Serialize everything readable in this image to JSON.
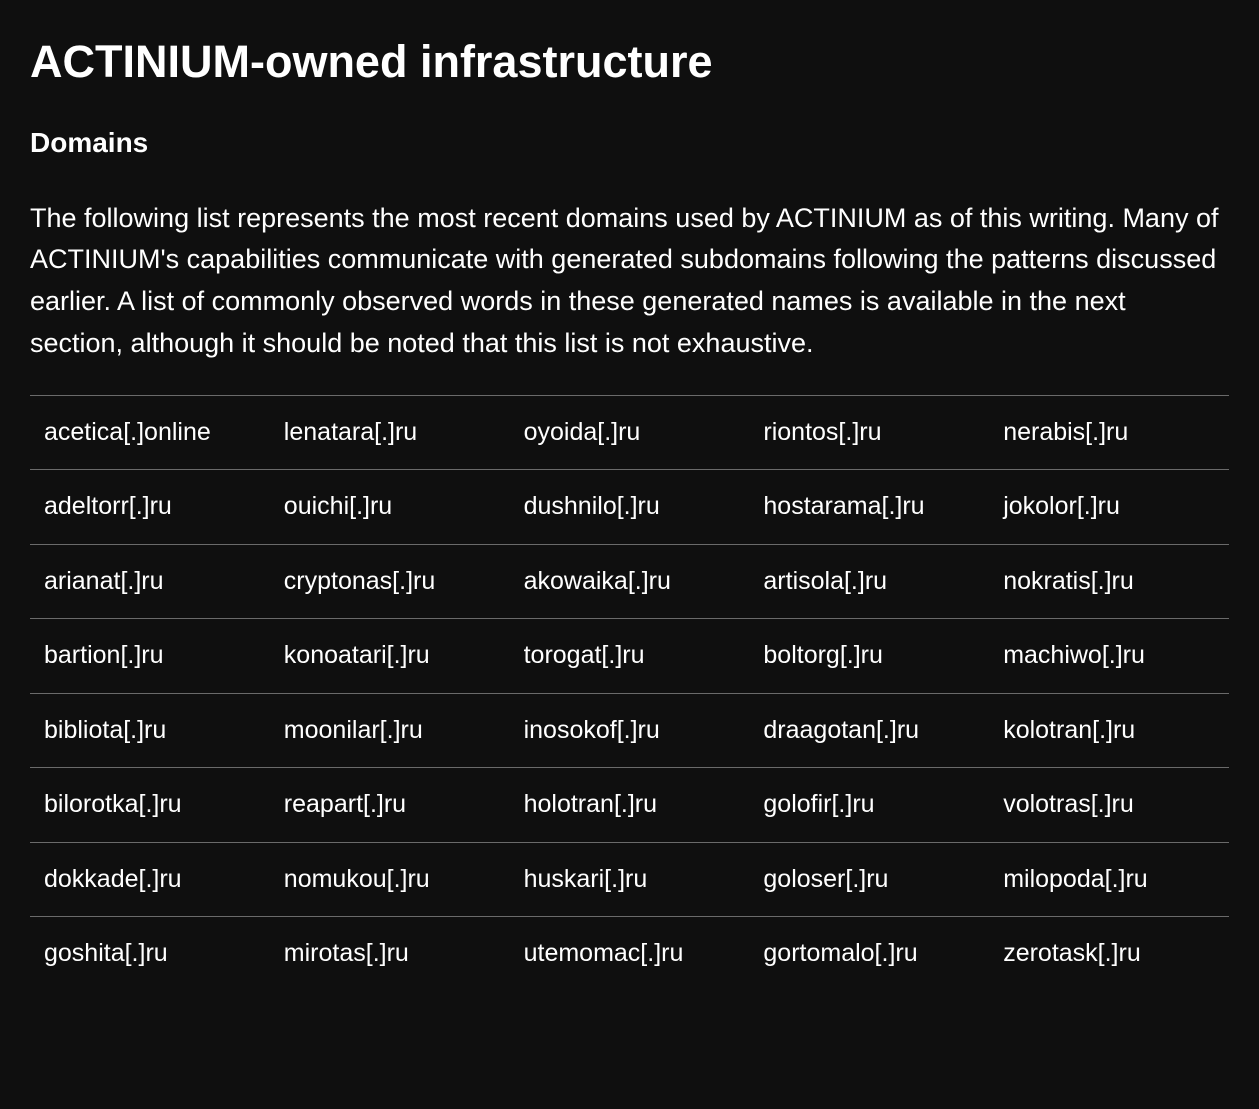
{
  "heading": "ACTINIUM-owned infrastructure",
  "subheading": "Domains",
  "intro": "The following list represents the most recent domains used by ACTINIUM as of this writing. Many of ACTINIUM's capabilities communicate with generated subdomains following the patterns discussed earlier. A list of commonly observed words in these generated names is available in the next section, although it should be noted that this list is not exhaustive.",
  "table": {
    "rows": [
      [
        "acetica[.]online",
        "lenatara[.]ru",
        "oyoida[.]ru",
        "riontos[.]ru",
        "nerabis[.]ru"
      ],
      [
        "adeltorr[.]ru",
        "ouichi[.]ru",
        "dushnilo[.]ru",
        "hostarama[.]ru",
        "jokolor[.]ru"
      ],
      [
        "arianat[.]ru",
        "cryptonas[.]ru",
        "akowaika[.]ru",
        "artisola[.]ru",
        "nokratis[.]ru"
      ],
      [
        "bartion[.]ru",
        "konoatari[.]ru",
        "torogat[.]ru",
        "boltorg[.]ru",
        "machiwo[.]ru"
      ],
      [
        "bibliota[.]ru",
        "moonilar[.]ru",
        "inosokof[.]ru",
        "draagotan[.]ru",
        "kolotran[.]ru"
      ],
      [
        "bilorotka[.]ru",
        "reapart[.]ru",
        "holotran[.]ru",
        "golofir[.]ru",
        "volotras[.]ru"
      ],
      [
        "dokkade[.]ru",
        "nomukou[.]ru",
        "huskari[.]ru",
        "goloser[.]ru",
        "milopoda[.]ru"
      ],
      [
        "goshita[.]ru",
        "mirotas[.]ru",
        "utemomac[.]ru",
        "gortomalo[.]ru",
        "zerotask[.]ru"
      ]
    ]
  }
}
